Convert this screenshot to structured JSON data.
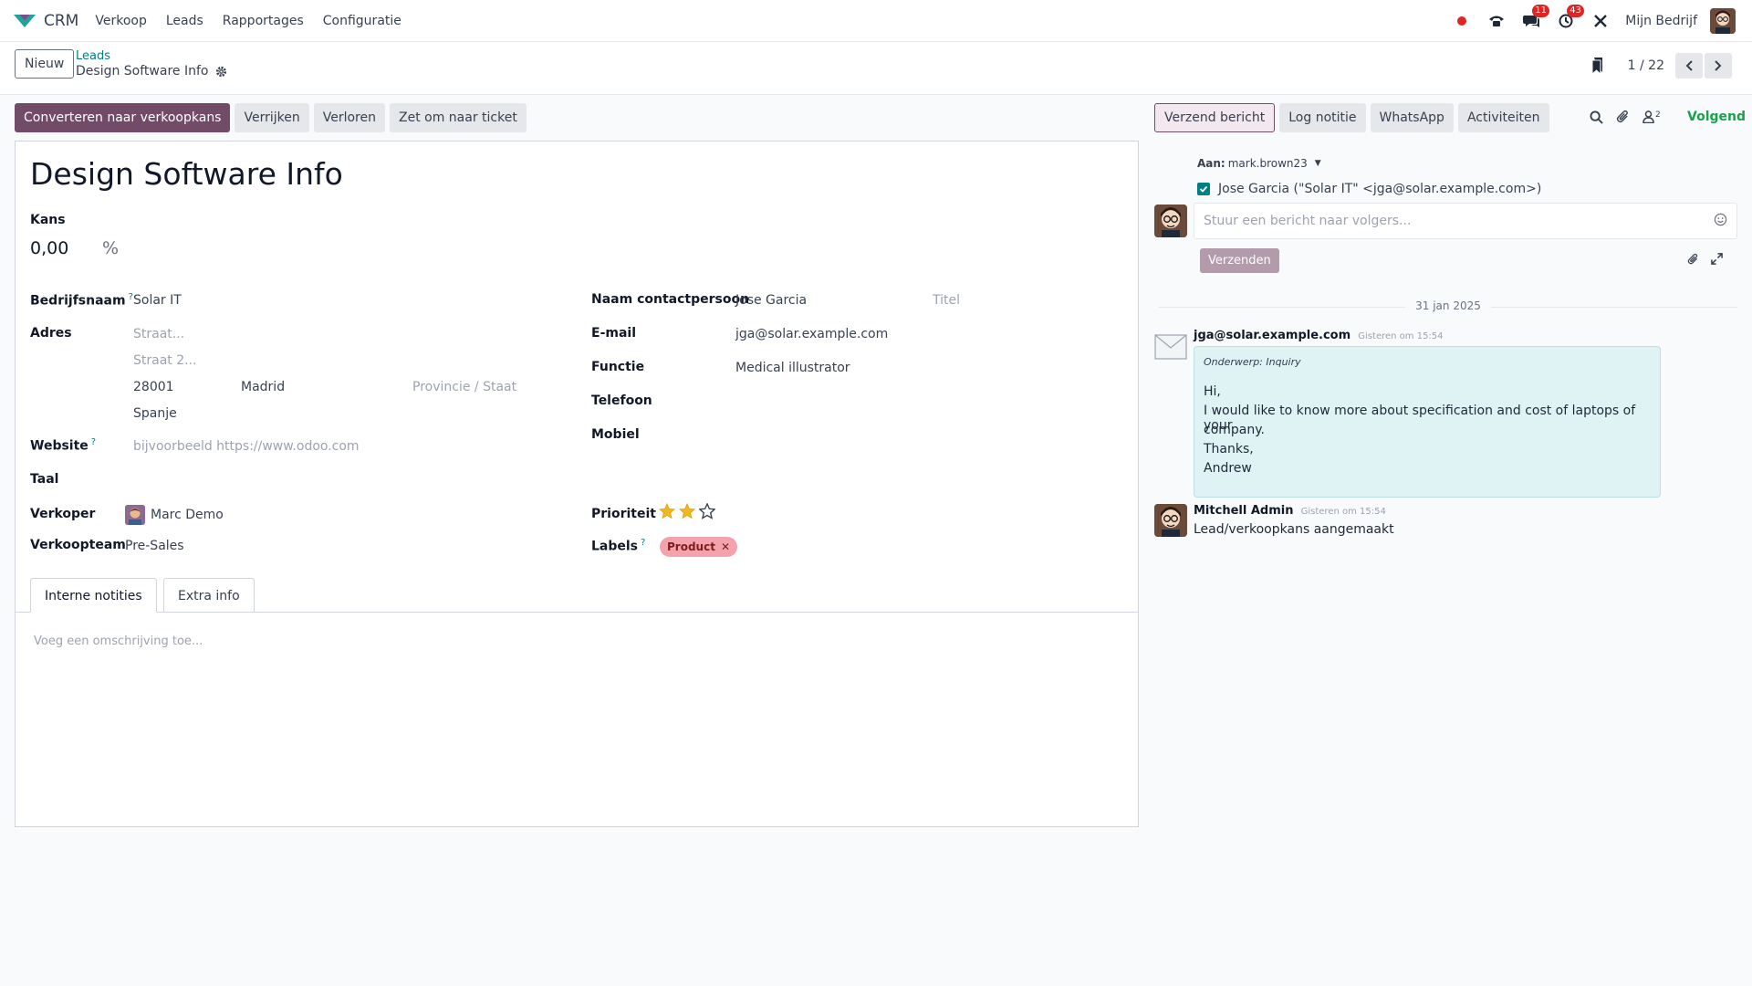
{
  "nav": {
    "app_name": "CRM",
    "menu": [
      "Verkoop",
      "Leads",
      "Rapportages",
      "Configuratie"
    ],
    "badges": {
      "messages": "11",
      "activities": "43"
    },
    "company": "Mijn Bedrijf"
  },
  "control_panel": {
    "new_label": "Nieuw",
    "breadcrumb_parent": "Leads",
    "breadcrumb_current": "Design Software Info",
    "pager": "1 / 22"
  },
  "actions": {
    "convert": "Converteren naar verkoopkans",
    "enrich": "Verrijken",
    "lost": "Verloren",
    "to_ticket": "Zet om naar ticket"
  },
  "form": {
    "title": "Design Software Info",
    "probability_label": "Kans",
    "probability_value": "0,00",
    "probability_unit": "%",
    "company_label": "Bedrijfsnaam",
    "company_value": "Solar IT",
    "address_label": "Adres",
    "street_ph": "Straat...",
    "street2_ph": "Straat 2...",
    "zip": "28001",
    "city": "Madrid",
    "state_ph": "Provincie / Staat",
    "country": "Spanje",
    "website_label": "Website",
    "website_ph": "bijvoorbeeld https://www.odoo.com",
    "language_label": "Taal",
    "salesperson_label": "Verkoper",
    "salesperson_value": "Marc Demo",
    "team_label": "Verkoopteam",
    "team_value": "Pre-Sales",
    "contact_label": "Naam contactpersoon",
    "contact_value": "Jose Garcia",
    "title_ph": "Titel",
    "email_label": "E-mail",
    "email_value": "jga@solar.example.com",
    "function_label": "Functie",
    "function_value": "Medical illustrator",
    "phone_label": "Telefoon",
    "mobile_label": "Mobiel",
    "priority_label": "Prioriteit",
    "priority_stars": 2,
    "priority_max": 3,
    "labels_label": "Labels",
    "tag": "Product",
    "help_mark": "?",
    "tabs": [
      "Interne notities",
      "Extra info"
    ],
    "notes_ph": "Voeg een omschrijving toe..."
  },
  "chatter": {
    "send_message": "Verzend bericht",
    "log_note": "Log notitie",
    "whatsapp": "WhatsApp",
    "activities": "Activiteiten",
    "followers_count": "2",
    "follow": "Volgend",
    "to_label": "Aan:",
    "to_value": "mark.brown23",
    "recipient": "Jose Garcia (\"Solar IT\" <jga@solar.example.com>)",
    "composer_ph": "Stuur een bericht naar volgers...",
    "send_btn": "Verzenden",
    "date": "31 jan 2025",
    "msg1_author": "jga@solar.example.com",
    "msg1_time": "Gisteren om 15:54",
    "msg1_subject": "Onderwerp: Inquiry",
    "msg1_lines": [
      "Hi,",
      "I would like to know more about specification and cost of laptops of your",
      "company.",
      "Thanks,",
      "Andrew"
    ],
    "msg2_author": "Mitchell Admin",
    "msg2_time": "Gisteren om 15:54",
    "msg2_body": "Lead/verkoopkans aangemaakt"
  },
  "colors": {
    "brand": "#714b67",
    "link": "#017e84",
    "follow": "#16a34a",
    "badge": "#dc2626"
  }
}
